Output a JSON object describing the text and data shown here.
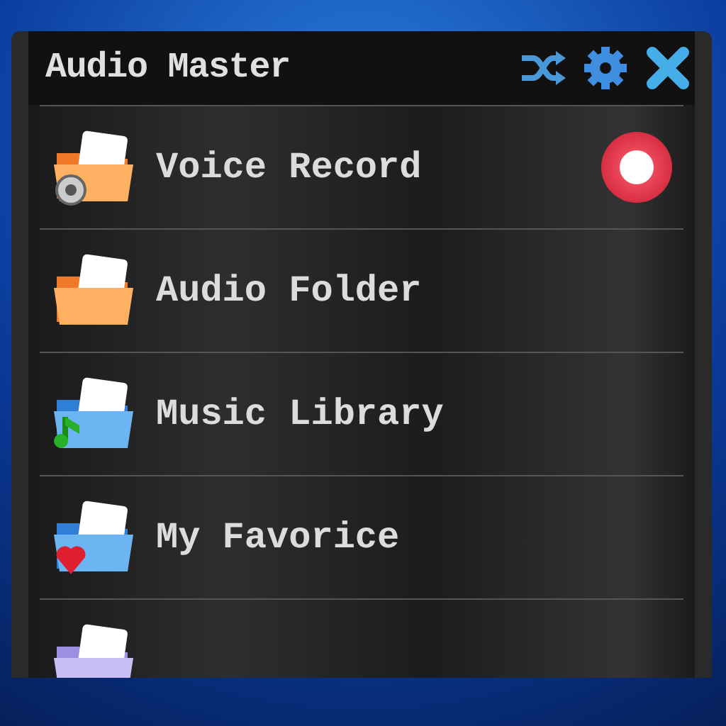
{
  "window": {
    "title": "Audio Master"
  },
  "toolbar": [
    {
      "kind": "shuffle"
    },
    {
      "kind": "settings"
    },
    {
      "kind": "close"
    }
  ],
  "items": [
    {
      "label": "Voice Record",
      "kind": "voice",
      "record_button": true
    },
    {
      "label": "Audio Folder",
      "kind": "audio",
      "record_button": false
    },
    {
      "label": "Music Library",
      "kind": "music",
      "record_button": false
    },
    {
      "label": "My Favorice",
      "kind": "favorite",
      "record_button": false
    },
    {
      "kind": "plain",
      "record_button": false
    }
  ]
}
